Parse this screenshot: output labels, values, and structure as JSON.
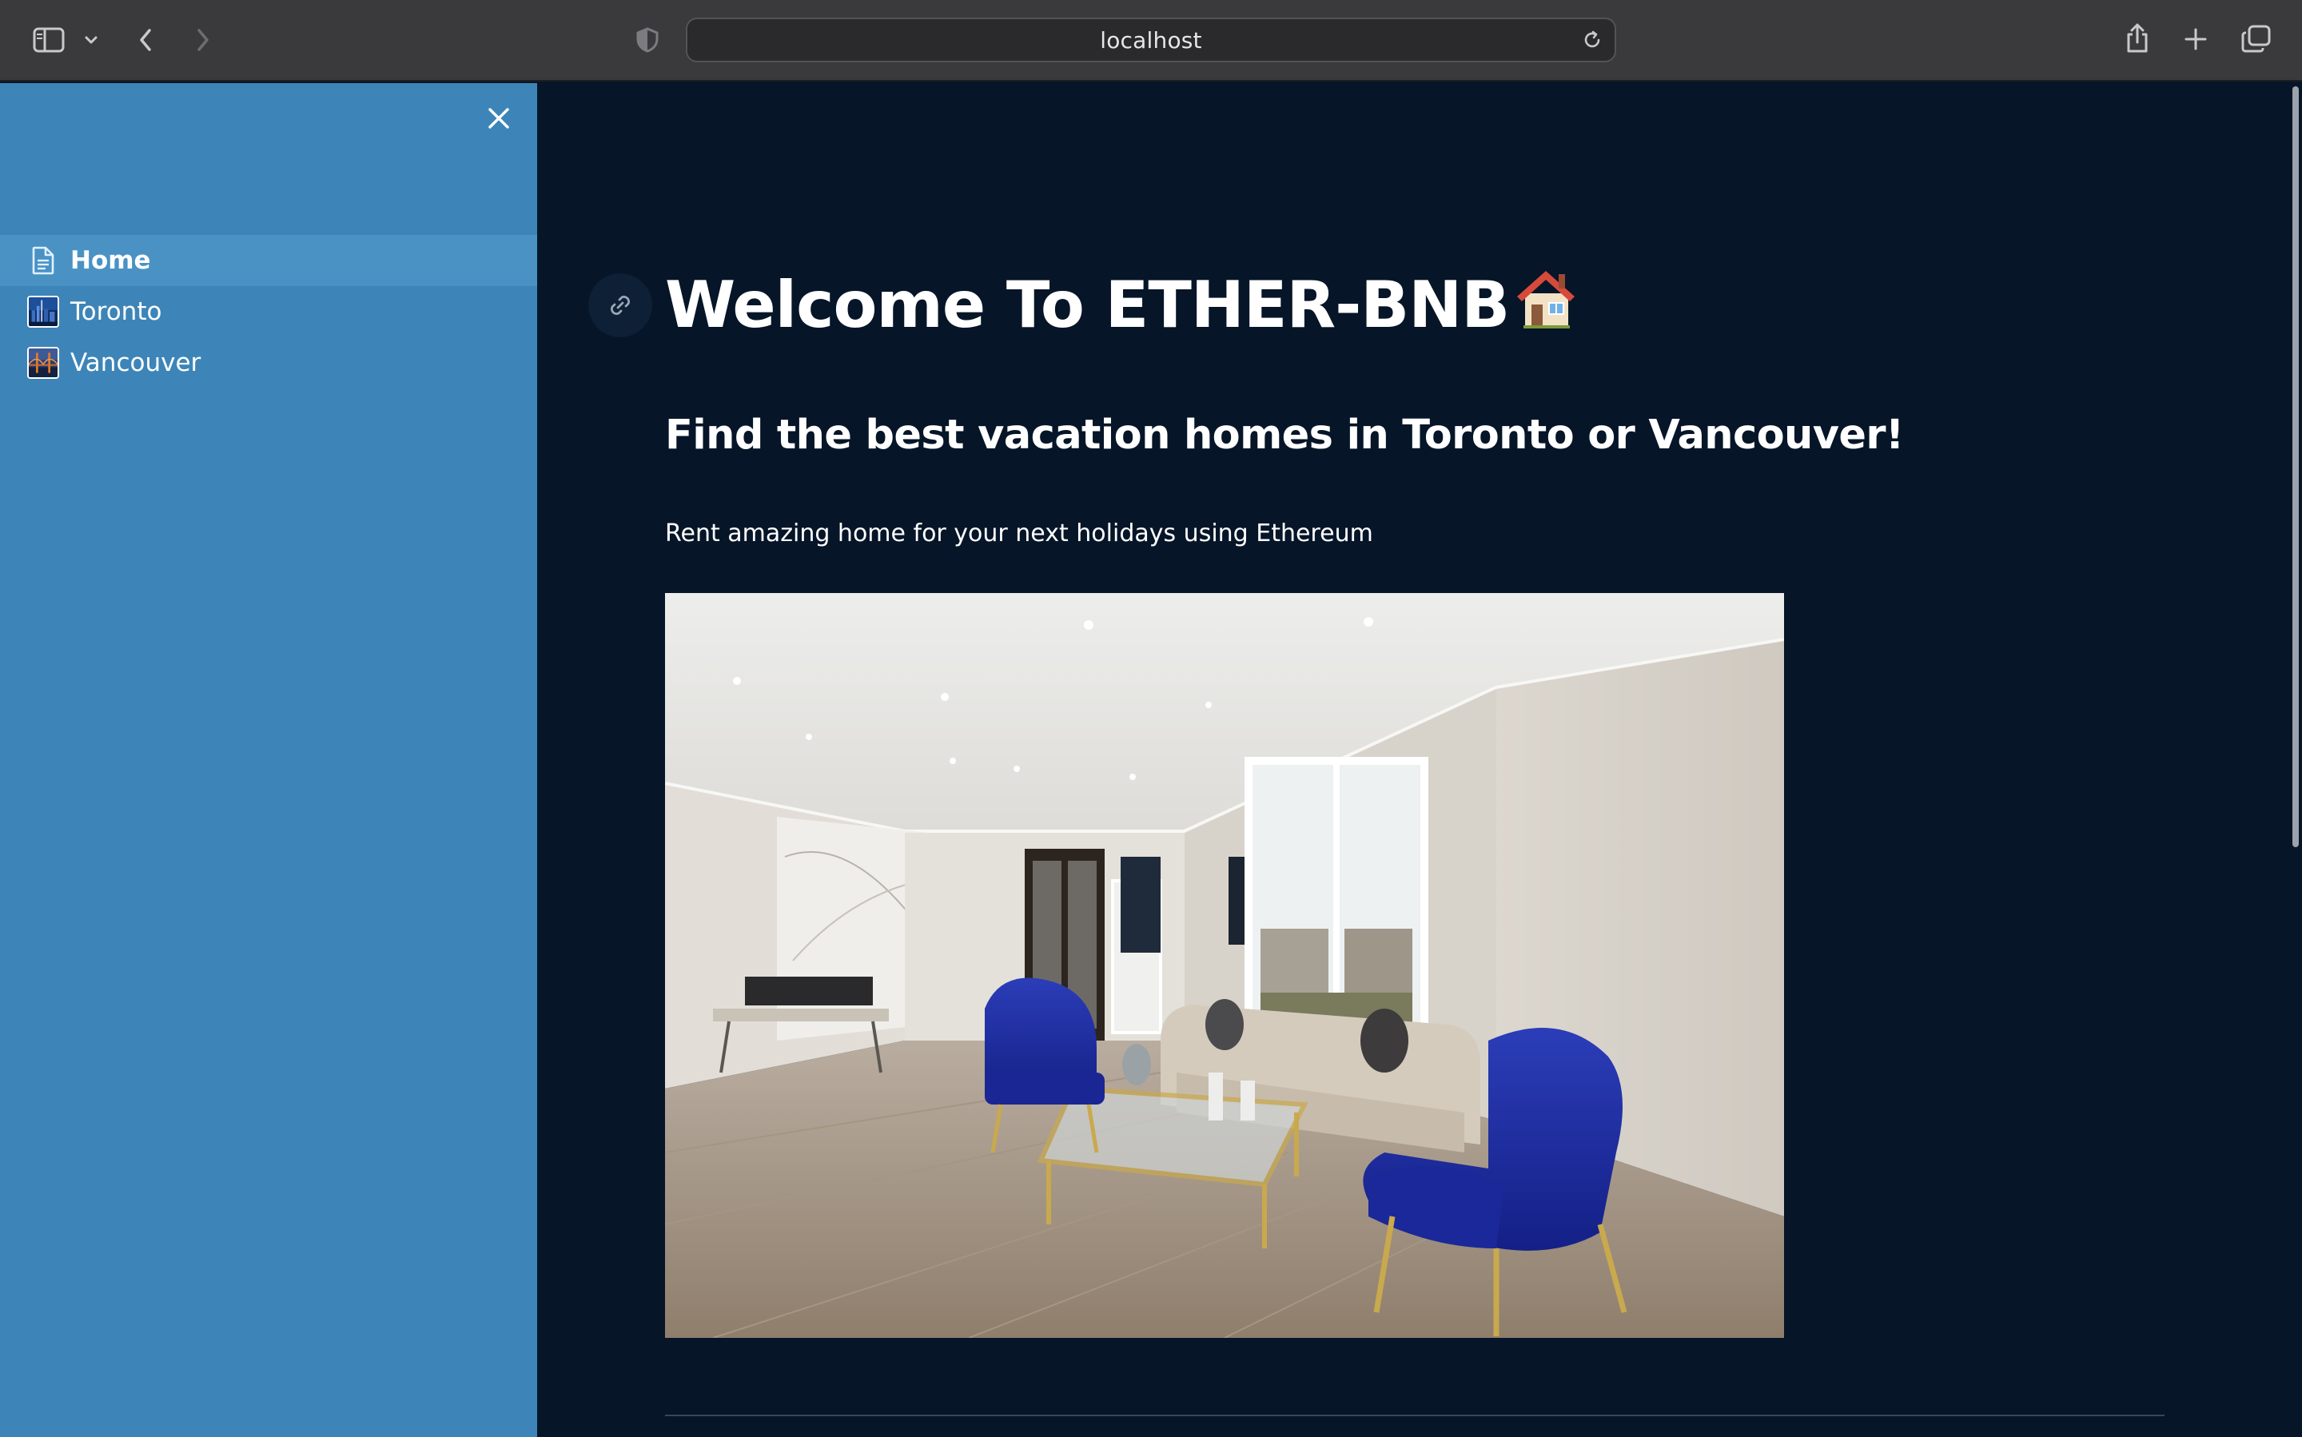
{
  "browser": {
    "url": "localhost",
    "icons": [
      "sidebar-toggle-icon",
      "chevron-down-icon",
      "back-arrow-icon",
      "forward-arrow-icon",
      "privacy-shield-icon",
      "reload-icon",
      "share-icon",
      "new-tab-plus-icon",
      "tab-overview-icon"
    ]
  },
  "sidebar": {
    "close_icon": "close-icon",
    "items": [
      {
        "label": "Home",
        "icon": "document-icon",
        "active": true
      },
      {
        "label": "Toronto",
        "icon": "toronto-thumbnail",
        "active": false
      },
      {
        "label": "Vancouver",
        "icon": "vancouver-thumbnail",
        "active": false
      }
    ],
    "background": "#3d85b8",
    "active_background": "#4a92c4"
  },
  "main": {
    "anchor_icon": "link-icon",
    "title": "Welcome To ETHER-BNB",
    "title_emoji": "house-emoji",
    "subtitle": "Find the best vacation homes in Toronto or Vancouver!",
    "lead": "Rent amazing home for your next holidays using Ethereum",
    "hero_image": "living-room-photo",
    "background": "#061528"
  }
}
